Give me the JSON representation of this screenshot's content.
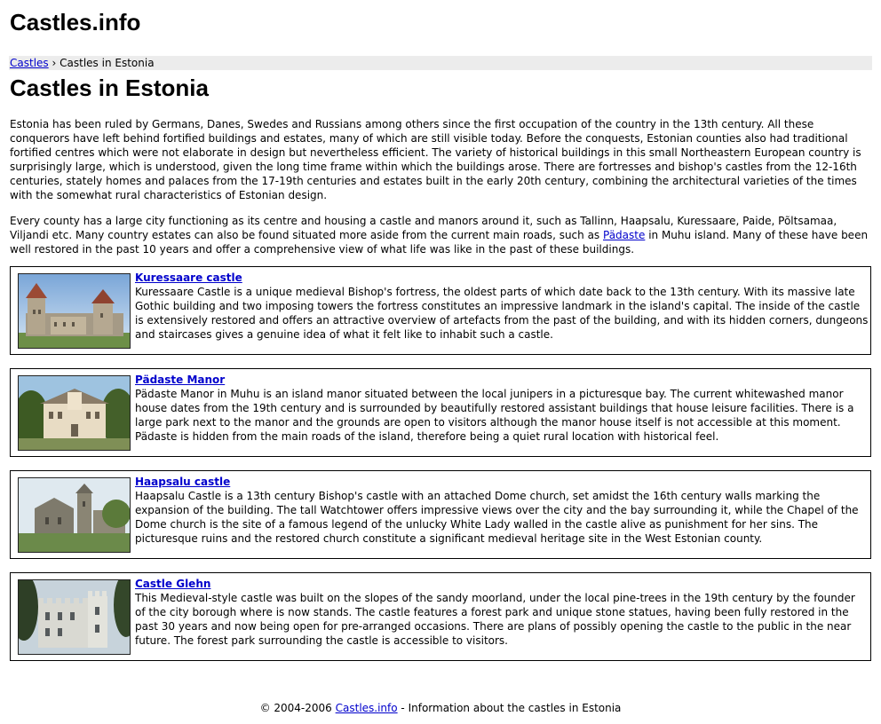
{
  "site": {
    "title": "Castles.info"
  },
  "breadcrumb": {
    "home_link": "Castles",
    "separator": "›",
    "current": "Castles in Estonia"
  },
  "page": {
    "title": "Castles in Estonia"
  },
  "intro": {
    "paragraph1": "Estonia has been ruled by Germans, Danes, Swedes and Russians among others since the first occupation of the country in the 13th century. All these conquerors have left behind fortified buildings and estates, many of which are still visible today. Before the conquests, Estonian counties also had traditional fortified centres which were not elaborate in design but nevertheless efficient. The variety of historical buildings in this small Northeastern European country is surprisingly large, which is understood, given the long time frame within which the buildings arose. There are fortresses and bishop's castles from the 12-16th centuries, stately homes and palaces from the 17-19th centuries and estates built in the early 20th century, combining the architectural varieties of the times with the somewhat rural characteristics of Estonian design.",
    "paragraph2_before": "Every county has a large city functioning as its centre and housing a castle and manors around it, such as Tallinn, Haapsalu, Kuressaare, Paide, Põltsamaa, Viljandi etc. Many country estates can also be found situated more aside from the current main roads, such as ",
    "paragraph2_link": "Pädaste",
    "paragraph2_after": " in Muhu island. Many of these have been well restored in the past 10 years and offer a comprehensive view of what life was like in the past of these buildings."
  },
  "castles": [
    {
      "title": "Kuressaare castle",
      "description": "Kuressaare Castle is a unique medieval Bishop's fortress, the oldest parts of which date back to the 13th century. With its massive late Gothic building and two imposing towers the fortress constitutes an impressive landmark in the island's capital. The inside of the castle is extensively restored and offers an attractive overview of artefacts from the past of the building, and with its hidden corners, dungeons and staircases gives a genuine idea of what it felt like to inhabit such a castle."
    },
    {
      "title": "Pädaste Manor",
      "description": "Pädaste Manor in Muhu is an island manor situated between the local junipers in a picturesque bay. The current whitewashed manor house dates from the 19th century and is surrounded by beautifully restored assistant buildings that house leisure facilities. There is a large park next to the manor and the grounds are open to visitors although the manor house itself is not accessible at this moment. Pädaste is hidden from the main roads of the island, therefore being a quiet rural location with historical feel."
    },
    {
      "title": "Haapsalu castle",
      "description": "Haapsalu Castle is a 13th century Bishop's castle with an attached Dome church, set amidst the 16th century walls marking the expansion of the building. The tall Watchtower offers impressive views over the city and the bay surrounding it, while the Chapel of the Dome church is the site of a famous legend of the unlucky White Lady walled in the castle alive as punishment for her sins. The picturesque ruins and the restored church constitute a significant medieval heritage site in the West Estonian county."
    },
    {
      "title": "Castle Glehn",
      "description": "This Medieval-style castle was built on the slopes of the sandy moorland, under the local pine-trees in the 19th century by the founder of the city borough where is now stands. The castle features a forest park and unique stone statues, having been fully restored in the past 30 years and now being open for pre-arranged occasions. There are plans of possibly opening the castle to the public in the near future. The forest park surrounding the castle is accessible to visitors."
    }
  ],
  "footer": {
    "prefix": "© 2004-2006 ",
    "link": "Castles.info",
    "suffix": " - Information about the castles in Estonia"
  },
  "colors": {
    "link": "#0000cc",
    "breadcrumb_bg": "#ececec",
    "border": "#000000"
  }
}
